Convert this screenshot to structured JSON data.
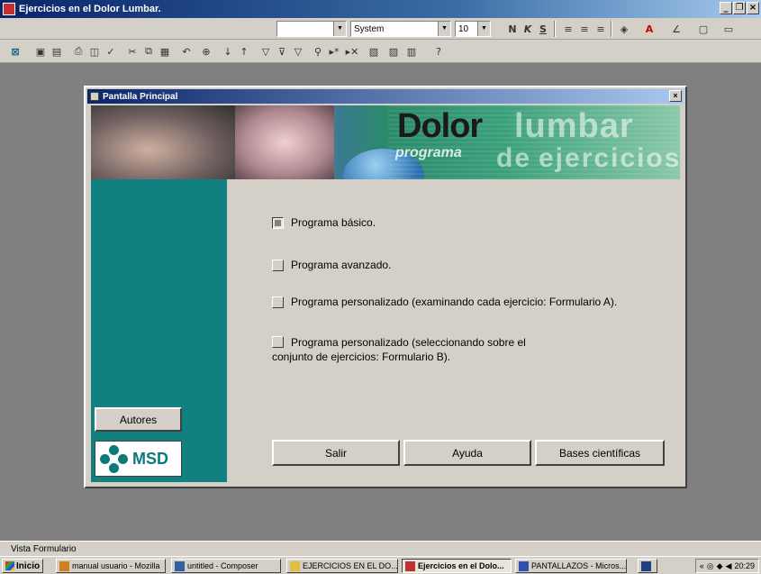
{
  "window": {
    "title": "Ejercicios en el Dolor Lumbar."
  },
  "toolbar1": {
    "font_name": "System",
    "font_size": "10",
    "bold": "N",
    "italic": "K",
    "underline": "S"
  },
  "dialog": {
    "title": "Pantalla Principal",
    "banner": {
      "word1": "Dolor",
      "word2": "lumbar",
      "word3": "programa",
      "word4": "de",
      "word5": "ejercicios"
    },
    "options": [
      {
        "label": "Programa básico.",
        "checked": true
      },
      {
        "label": "Programa avanzado.",
        "checked": false
      },
      {
        "label": "Programa personalizado (examinando cada ejercicio: Formulario A).",
        "checked": false
      },
      {
        "label_line1": "Programa personalizado (seleccionando sobre el",
        "label_line2": "conjunto de ejercicios: Formulario B).",
        "checked": false
      }
    ],
    "autores_button": "Autores",
    "logo_text": "MSD",
    "buttons": {
      "salir": "Salir",
      "ayuda": "Ayuda",
      "bases": "Bases científicas"
    }
  },
  "statusbar": {
    "text": "Vista Formulario"
  },
  "taskbar": {
    "start": "Inicio",
    "tasks": [
      "manual usuario - Mozilla",
      "untitled - Composer",
      "EJERCICIOS EN EL DO...",
      "Ejercicios en el Dolo...",
      "PANTALLAZOS - Micros..."
    ],
    "clock": "20:29"
  }
}
